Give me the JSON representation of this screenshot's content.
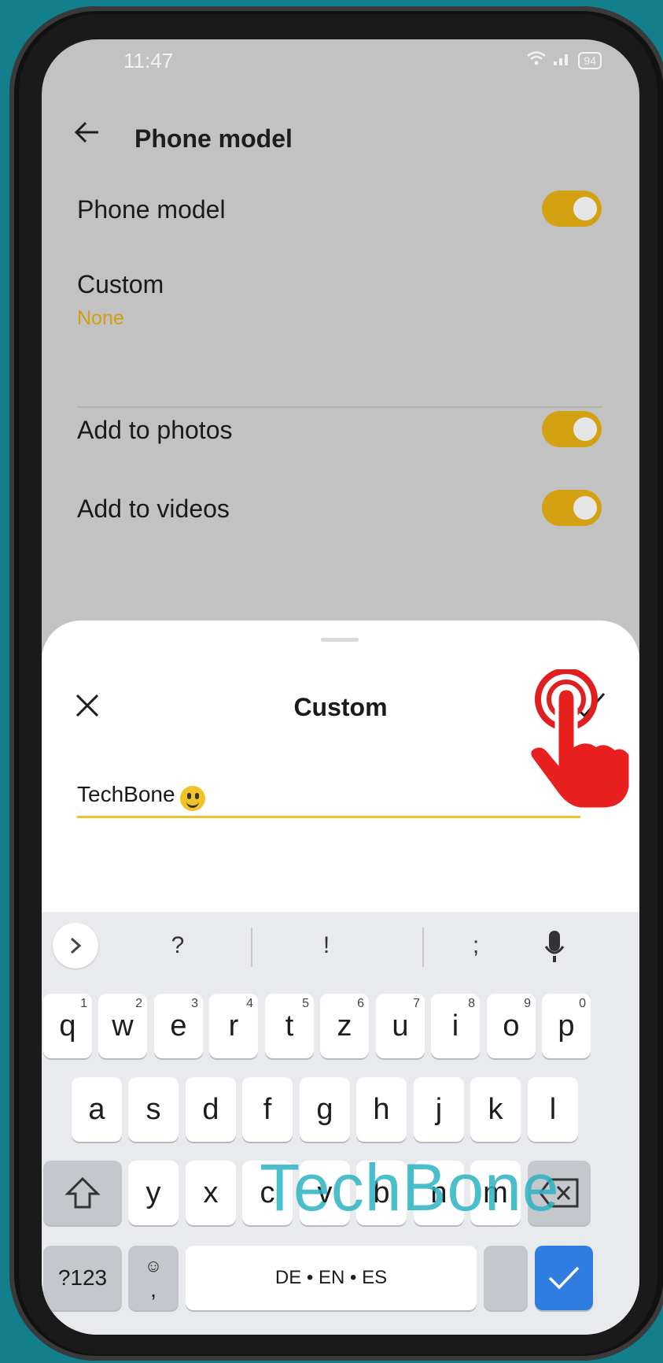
{
  "status_bar": {
    "time": "11:47",
    "battery": "94"
  },
  "header": {
    "title": "Phone model"
  },
  "settings": {
    "phone_model_label": "Phone model",
    "custom_label": "Custom",
    "custom_value": "None",
    "add_to_photos_label": "Add to photos",
    "add_to_videos_label": "Add to videos"
  },
  "dialog": {
    "title": "Custom",
    "input_value": "TechBone"
  },
  "keyboard": {
    "suggestions": [
      "?",
      "!",
      ";"
    ],
    "row1": [
      {
        "key": "q",
        "num": "1"
      },
      {
        "key": "w",
        "num": "2"
      },
      {
        "key": "e",
        "num": "3"
      },
      {
        "key": "r",
        "num": "4"
      },
      {
        "key": "t",
        "num": "5"
      },
      {
        "key": "z",
        "num": "6"
      },
      {
        "key": "u",
        "num": "7"
      },
      {
        "key": "i",
        "num": "8"
      },
      {
        "key": "o",
        "num": "9"
      },
      {
        "key": "p",
        "num": "0"
      }
    ],
    "row2": [
      "a",
      "s",
      "d",
      "f",
      "g",
      "h",
      "j",
      "k",
      "l"
    ],
    "row3": [
      "y",
      "x",
      "c",
      "v",
      "b",
      "n",
      "m"
    ],
    "symbols_label": "?123",
    "comma_label": ",",
    "space_label": "DE • EN • ES"
  },
  "watermark": "TechBone",
  "colors": {
    "accent": "#d4a112",
    "underline": "#f0c02c",
    "enter": "#2f7de1",
    "background": "#137f8c"
  }
}
